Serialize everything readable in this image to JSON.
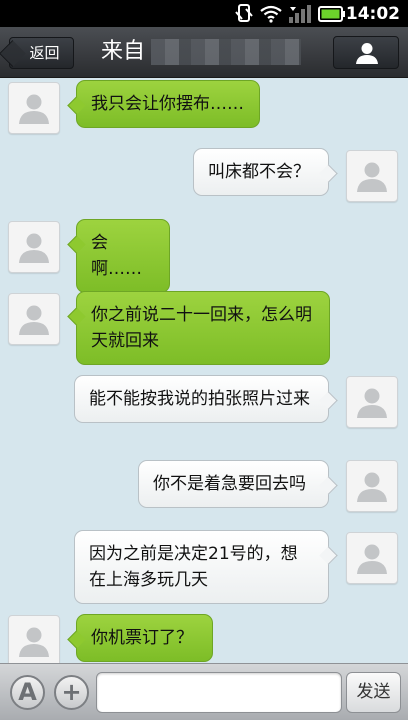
{
  "status_bar": {
    "time": "14:02",
    "icons": [
      "sync-icon",
      "wifi-icon",
      "signal-icon",
      "battery-icon"
    ]
  },
  "header": {
    "back_label": "返回",
    "title": "来自",
    "profile_icon": "person-icon"
  },
  "messages": [
    {
      "side": "in",
      "text": "我只会让你摆布……"
    },
    {
      "side": "out",
      "text": "叫床都不会？"
    },
    {
      "side": "in",
      "text": "会啊……"
    },
    {
      "side": "in",
      "text": "你之前说二十一回来，怎么明天就回来"
    },
    {
      "side": "out",
      "text": "能不能按我说的拍张照片过来"
    },
    {
      "side": "out",
      "text": "你不是着急要回去吗"
    },
    {
      "side": "out",
      "text": "因为之前是决定21号的，想在上海多玩几天"
    },
    {
      "side": "in",
      "text": "你机票订了？"
    }
  ],
  "input_bar": {
    "font_button": "A",
    "add_button": "+",
    "input_value": "",
    "send_label": "发送"
  },
  "colors": {
    "incoming_bubble": "#8ec92f",
    "outgoing_bubble": "#ffffff",
    "chat_background": "#d6e6ed"
  }
}
